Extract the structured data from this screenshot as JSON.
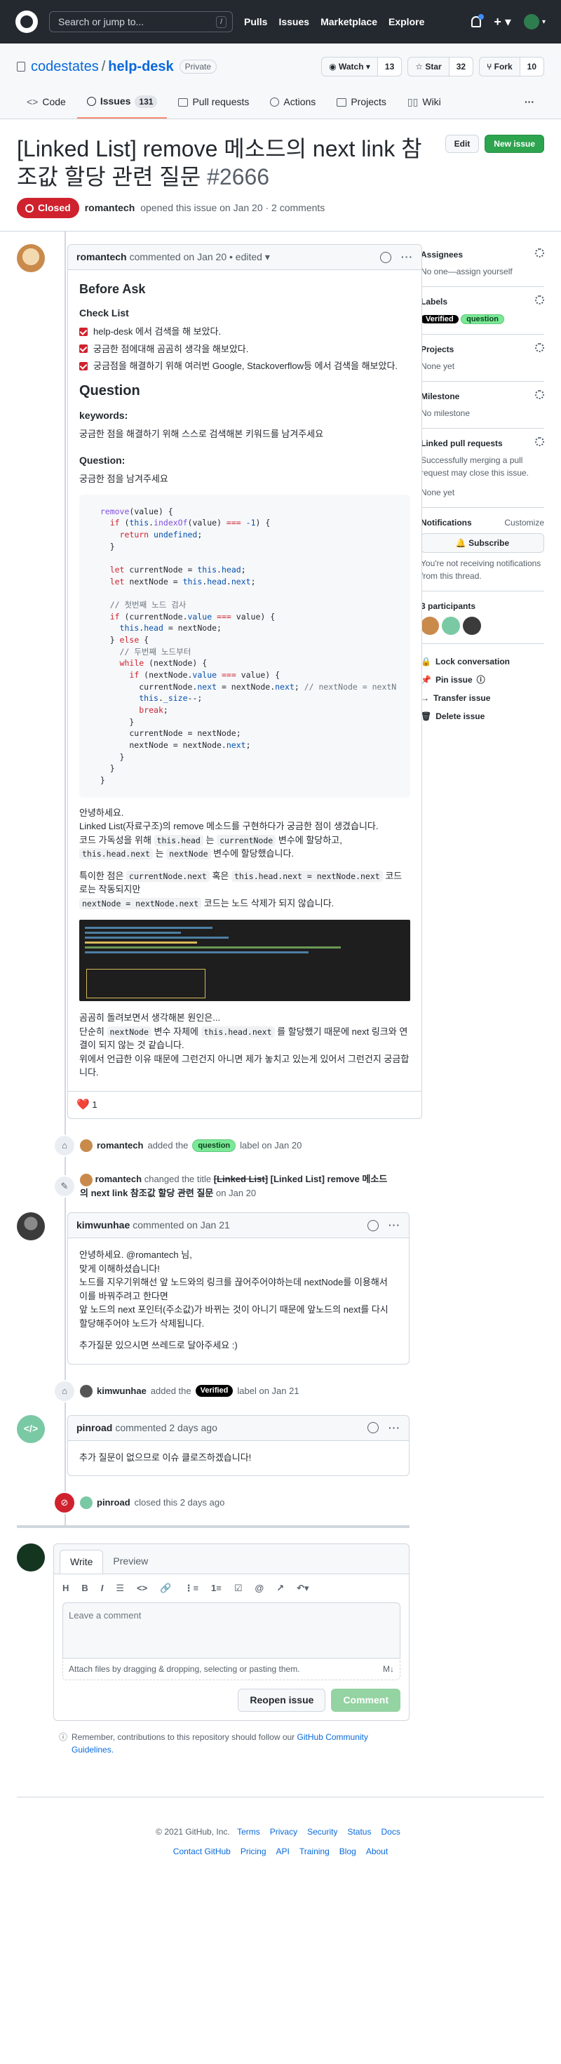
{
  "header": {
    "search_placeholder": "Search or jump to...",
    "search_kbd": "/",
    "nav": [
      "Pulls",
      "Issues",
      "Marketplace",
      "Explore"
    ]
  },
  "repo": {
    "owner": "codestates",
    "name": "help-desk",
    "visibility": "Private",
    "watch": "Watch",
    "watch_count": "13",
    "star": "Star",
    "star_count": "32",
    "fork": "Fork",
    "fork_count": "10"
  },
  "tabs": [
    {
      "label": "Code"
    },
    {
      "label": "Issues",
      "count": "131"
    },
    {
      "label": "Pull requests"
    },
    {
      "label": "Actions"
    },
    {
      "label": "Projects"
    },
    {
      "label": "Wiki"
    }
  ],
  "issue": {
    "title": "[Linked List] remove 메소드의 next link 참조값 할당 관련 질문",
    "number": "#2666",
    "edit": "Edit",
    "new_issue": "New issue",
    "state": "Closed",
    "author": "romantech",
    "opened": "opened this issue on Jan 20 · 2 comments"
  },
  "c1": {
    "author": "romantech",
    "meta": "commented on Jan 20 • edited",
    "before": "Before Ask",
    "checklist": "Check List",
    "checks": [
      "help-desk 에서 검색을 해 보았다.",
      "궁금한 점에대해 곰곰히 생각을 해보았다.",
      "궁금점을 해결하기 위해 여러번 Google, Stackoverflow등 에서 검색을 해보았다."
    ],
    "question": "Question",
    "kw_h": "keywords:",
    "kw": "궁금한 점을 해결하기 위해 스스로 검색해본 키워드를 남겨주세요",
    "q_h": "Question:",
    "q": "궁금한 점을 남겨주세요",
    "p1": "안녕하세요.",
    "p2": "Linked List(자료구조)의 remove 메소드를 구현하다가 궁금한 점이 생겼습니다.",
    "p3": "코드 가독성을 위해",
    "p3c1": "this.head",
    "p3m": "는",
    "p3c2": "currentNode",
    "p3e": "변수에 할당하고,",
    "p4c1": "this.head.next",
    "p4m": "는",
    "p4c2": "nextNode",
    "p4e": "변수에 할당했습니다.",
    "p5": "특이한 점은",
    "p5c1": "currentNode.next",
    "p5m": "혹은",
    "p5c2": "this.head.next = nextNode.next",
    "p5e": "코드로는 작동되지만",
    "p6c": "nextNode = nextNode.next",
    "p6e": "코드는 노드 삭제가 되지 않습니다.",
    "p7": "곰곰히 돌려보면서 생각해본 원인은...",
    "p8": "단순히",
    "p8c1": "nextNode",
    "p8m": "변수 자체에",
    "p8c2": "this.head.next",
    "p8e": "를 할당했기 때문에 next 링크와 연결이 되지 않는 것 같습니다.",
    "p9": "위에서 언급한 이유 때문에 그런건지 아니면 제가 놓치고 있는게 있어서 그런건지 궁금합니다.",
    "reaction": "1"
  },
  "e1": {
    "user": "romantech",
    "a": "added the",
    "label": "question",
    "b": "label on Jan 20"
  },
  "e2": {
    "user": "romantech",
    "a": "changed the title",
    "old": "[Linked List]",
    "new": "[Linked List] remove 메소드의 next link 참조값 할당 관련 질문",
    "b": "on Jan 20"
  },
  "c2": {
    "author": "kimwunhae",
    "meta": "commented on Jan 21",
    "l1": "안녕하세요. @romantech 님,",
    "l2": "맞게 이해하셨습니다!",
    "l3": "노드를 지우기위해선 앞 노드와의 링크를 끊어주어야하는데 nextNode를 이용해서 이를 바꿔주려고 한다면",
    "l4": "앞 노드의 next 포인터(주소값)가 바뀌는 것이 아니기 때문에 앞노드의 next를 다시 할당해주어야 노드가 삭제됩니다.",
    "l5": "추가질문 있으시면 쓰레드로 달아주세요 :)"
  },
  "e3": {
    "user": "kimwunhae",
    "a": "added the",
    "label": "Verified",
    "b": "label on Jan 21"
  },
  "c3": {
    "author": "pinroad",
    "meta": "commented 2 days ago",
    "l1": "추가 질문이 없으므로 이슈 클로즈하겠습니다!"
  },
  "e4": {
    "user": "pinroad",
    "b": "closed this 2 days ago"
  },
  "composer": {
    "write": "Write",
    "preview": "Preview",
    "placeholder": "Leave a comment",
    "attach": "Attach files by dragging & dropping, selecting or pasting them.",
    "md": "M↓",
    "reopen": "Reopen issue",
    "comment": "Comment",
    "note": "Remember, contributions to this repository should follow our",
    "note_link": "GitHub Community Guidelines."
  },
  "sidebar": {
    "assignees": "Assignees",
    "assignees_v": "No one—assign yourself",
    "labels": "Labels",
    "labels_v": [
      "Verified",
      "question"
    ],
    "projects": "Projects",
    "projects_v": "None yet",
    "milestone": "Milestone",
    "milestone_v": "No milestone",
    "linked": "Linked pull requests",
    "linked_v": "Successfully merging a pull request may close this issue.",
    "linked_v2": "None yet",
    "notif": "Notifications",
    "customize": "Customize",
    "subscribe": "Subscribe",
    "notif_v": "You're not receiving notifications from this thread.",
    "participants": "3 participants",
    "lock": "Lock conversation",
    "pin": "Pin issue",
    "transfer": "Transfer issue",
    "delete": "Delete issue"
  },
  "footer": {
    "copy": "© 2021 GitHub, Inc.",
    "links1": [
      "Terms",
      "Privacy",
      "Security",
      "Status",
      "Docs"
    ],
    "links2": [
      "Contact GitHub",
      "Pricing",
      "API",
      "Training",
      "Blog",
      "About"
    ]
  },
  "colors": {
    "closed": "#cf222e",
    "green": "#2da44e",
    "question": "#7ae996",
    "verified": "#000000"
  }
}
